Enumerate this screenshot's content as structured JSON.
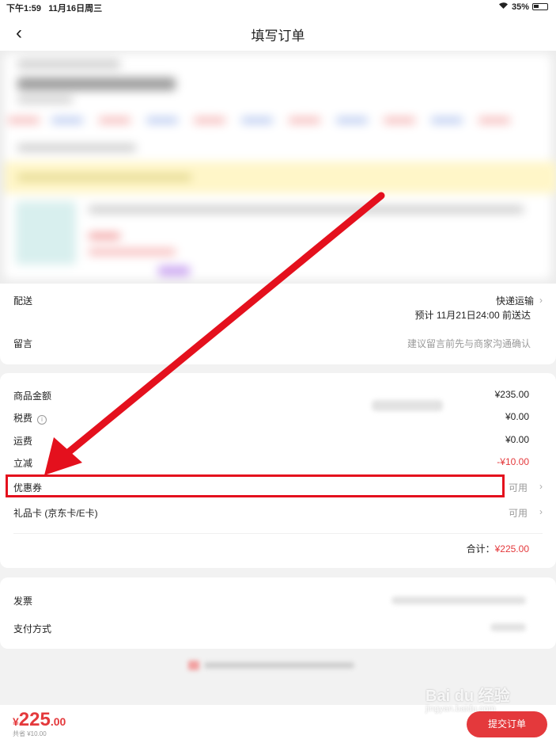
{
  "status_bar": {
    "time": "下午1:59",
    "date": "11月16日周三",
    "battery": "35%"
  },
  "nav": {
    "back_glyph": "‹",
    "title": "填写订单"
  },
  "delivery": {
    "label": "配送",
    "method": "快递运输",
    "eta": "预计 11月21日24:00 前送达",
    "note_label": "留言",
    "note_placeholder": "建议留言前先与商家沟通确认"
  },
  "summary": {
    "goods_label": "商品金额",
    "goods_value": "¥235.00",
    "tax_label": "税费",
    "tax_value": "¥0.00",
    "shipping_label": "运费",
    "shipping_value": "¥0.00",
    "discount_label": "立减",
    "discount_value": "-¥10.00",
    "coupon_label": "优惠券",
    "coupon_value": "可用",
    "giftcard_label": "礼品卡 (京东卡/E卡)",
    "giftcard_value": "可用",
    "total_label": "合计：",
    "total_value": "¥225.00"
  },
  "misc": {
    "invoice_label": "发票",
    "payment_label": "支付方式"
  },
  "bottom": {
    "currency": "¥",
    "price_int": "225",
    "price_dec": ".00",
    "saved": "共省 ¥10.00",
    "submit_label": "提交订单"
  },
  "watermark": {
    "brand": "Bai du 经验",
    "url": "jingyan.baidu.com"
  },
  "colors": {
    "accent": "#e4393c",
    "annotation": "#e4101d"
  },
  "icons": {
    "back": "chevron-left-icon",
    "tax_info": "info-icon",
    "row_arrow": "chevron-right-icon",
    "battery": "battery-icon",
    "wifi": "wifi-icon"
  }
}
